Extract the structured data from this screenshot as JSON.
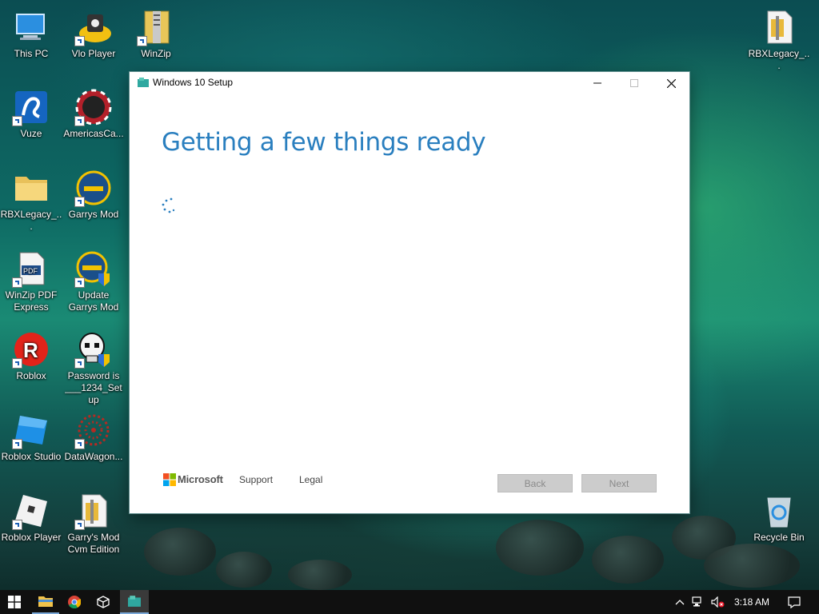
{
  "desktop": {
    "icons": [
      {
        "label": "This PC",
        "icon": "this-pc-icon"
      },
      {
        "label": "Vlo Player",
        "icon": "vlo-player-icon"
      },
      {
        "label": "WinZip",
        "icon": "winzip-icon"
      },
      {
        "label": "RBXLegacy_...",
        "icon": "zip-folder-icon"
      },
      {
        "label": "Vuze",
        "icon": "vuze-icon"
      },
      {
        "label": "AmericasCa...",
        "icon": "casino-chip-icon"
      },
      {
        "label": "RBXLegacy_...",
        "icon": "folder-icon"
      },
      {
        "label": "Garrys Mod",
        "icon": "garrys-mod-icon"
      },
      {
        "label": "WinZip PDF Express",
        "icon": "pdf-icon"
      },
      {
        "label": "Update Garrys Mod",
        "icon": "garrys-mod-update-icon"
      },
      {
        "label": "Roblox",
        "icon": "roblox-icon"
      },
      {
        "label": "Password is ___1234_Setup",
        "icon": "skull-setup-icon"
      },
      {
        "label": "Roblox Studio",
        "icon": "roblox-studio-icon"
      },
      {
        "label": "DataWagon...",
        "icon": "datawagon-icon"
      },
      {
        "label": "Roblox Player",
        "icon": "roblox-player-icon"
      },
      {
        "label": "Garry's Mod Cvm Edition",
        "icon": "zip-archive-icon"
      },
      {
        "label": "Recycle Bin",
        "icon": "recycle-bin-icon"
      }
    ]
  },
  "setup_window": {
    "title": "Windows 10 Setup",
    "heading": "Getting a few things ready",
    "footer": {
      "brand": "Microsoft",
      "support_link": "Support",
      "legal_link": "Legal",
      "back_label": "Back",
      "next_label": "Next"
    }
  },
  "taskbar": {
    "time": "3:18 AM",
    "apps": [
      "start-icon",
      "file-explorer-icon",
      "chrome-icon",
      "box-app-icon",
      "setup-app-icon"
    ]
  },
  "colors": {
    "heading": "#2a7fbf",
    "taskbar": "#101010",
    "disabled_button": "#cccccc"
  }
}
